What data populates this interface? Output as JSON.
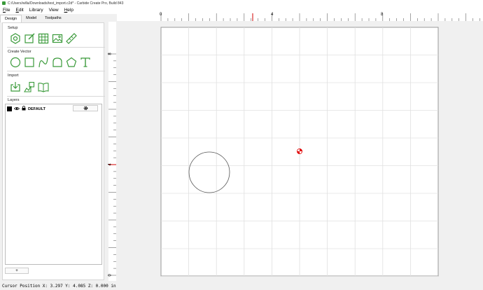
{
  "window": {
    "title": "C:/Users/willa/Downloads/test_import.c2d* - Carbide Create Pro, Build 843"
  },
  "menu": {
    "items": [
      {
        "first": "F",
        "rest": "ile"
      },
      {
        "first": "E",
        "rest": "dit"
      },
      {
        "first": "",
        "rest": "Library"
      },
      {
        "first": "",
        "rest": "View"
      },
      {
        "first": "H",
        "rest": "elp"
      }
    ]
  },
  "tabs": [
    "Design",
    "Model",
    "Toolpaths"
  ],
  "sidebar": {
    "setup_label": "Setup",
    "create_vector_label": "Create Vector",
    "import_label": "Import",
    "layers_label": "Layers",
    "layer": {
      "name": "DEFAULT",
      "color": "#000000"
    },
    "add_layer_label": "+"
  },
  "icons": {
    "setup": [
      "job-setup-icon",
      "edit-icon",
      "grid-icon",
      "image-icon",
      "measure-icon"
    ],
    "create_vector": [
      "circle-icon",
      "rectangle-icon",
      "curve-icon",
      "polygon-arch-icon",
      "polygon-icon",
      "text-icon"
    ],
    "import": [
      "import-svg-icon",
      "import-image-icon",
      "library-icon"
    ]
  },
  "ruler": {
    "top_labels": [
      "0",
      "4",
      "8"
    ],
    "left_labels": [
      "8",
      "4",
      "0"
    ],
    "cursor_marker_color": "#d00000"
  },
  "status": {
    "cursor_position": "Cursor Position X: 3.297 Y: 4.085 Z: 0.000 in"
  },
  "colors": {
    "accent": "#3a9a3a",
    "grid": "#e0e0e0",
    "origin_marker": "#e00000"
  }
}
